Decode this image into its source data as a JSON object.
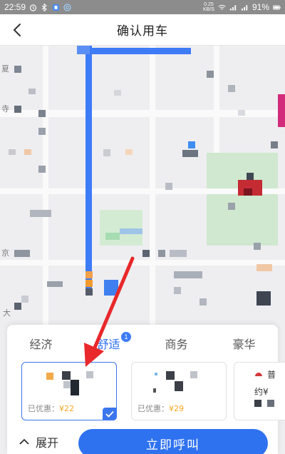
{
  "statusbar": {
    "time": "22:59",
    "net_speed_top": "0.25",
    "net_speed_bottom": "KB/S",
    "battery": "91%"
  },
  "header": {
    "title": "确认用车"
  },
  "map": {
    "labels": [
      "夏",
      "寺",
      "京",
      "大"
    ]
  },
  "tabs": [
    {
      "label": "经济"
    },
    {
      "label": "舒适",
      "badge": "1"
    },
    {
      "label": "商务"
    },
    {
      "label": "豪华"
    }
  ],
  "cards": [
    {
      "discount_label": "已优惠：",
      "price": "¥22"
    },
    {
      "discount_label": "已优惠：",
      "price": "¥29"
    },
    {
      "prefix": "约",
      "price_partial": "¥",
      "top_text": "普"
    }
  ],
  "actions": {
    "expand_label": "展开",
    "call_label": "立即呼叫"
  },
  "colors": {
    "accent": "#2f72f0",
    "price": "#f5a623",
    "route": "#3d7bf7",
    "annotation": "#e8282b"
  }
}
